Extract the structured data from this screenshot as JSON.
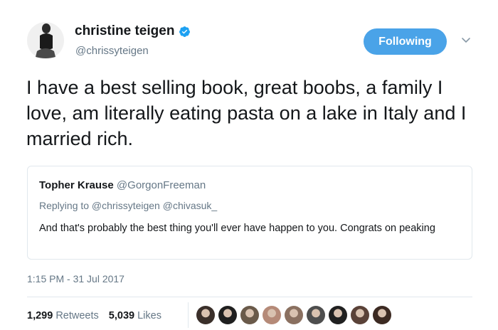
{
  "author": {
    "name": "christine teigen",
    "handle": "@chrissyteigen",
    "verified": true,
    "avatar_icon": "profile-photo-icon"
  },
  "follow_button": {
    "label": "Following",
    "color": "#4aa3e8"
  },
  "menu_icon": "chevron-down-icon",
  "tweet": {
    "text": "I have a best selling book, great boobs, a family I love, am literally eating pasta on a lake in Italy and I married rich."
  },
  "quoted_tweet": {
    "name": "Topher Krause",
    "handle": "@GorgonFreeman",
    "replying_to": "Replying to @chrissyteigen @chivasuk_",
    "text": "And that's probably the best thing you'll ever have happen to you. Congrats on peaking"
  },
  "timestamp": "1:15 PM - 31 Jul 2017",
  "stats": {
    "retweets_count": "1,299",
    "retweets_label": "Retweets",
    "likes_count": "5,039",
    "likes_label": "Likes"
  },
  "likers": [
    {
      "color": "#3a2f2a"
    },
    {
      "color": "#1f1f1f"
    },
    {
      "color": "#6a5a4a"
    },
    {
      "color": "#b58a78"
    },
    {
      "color": "#8a7060"
    },
    {
      "color": "#4e4e4e"
    },
    {
      "color": "#202020"
    },
    {
      "color": "#5a4238"
    },
    {
      "color": "#3c2a22"
    }
  ]
}
